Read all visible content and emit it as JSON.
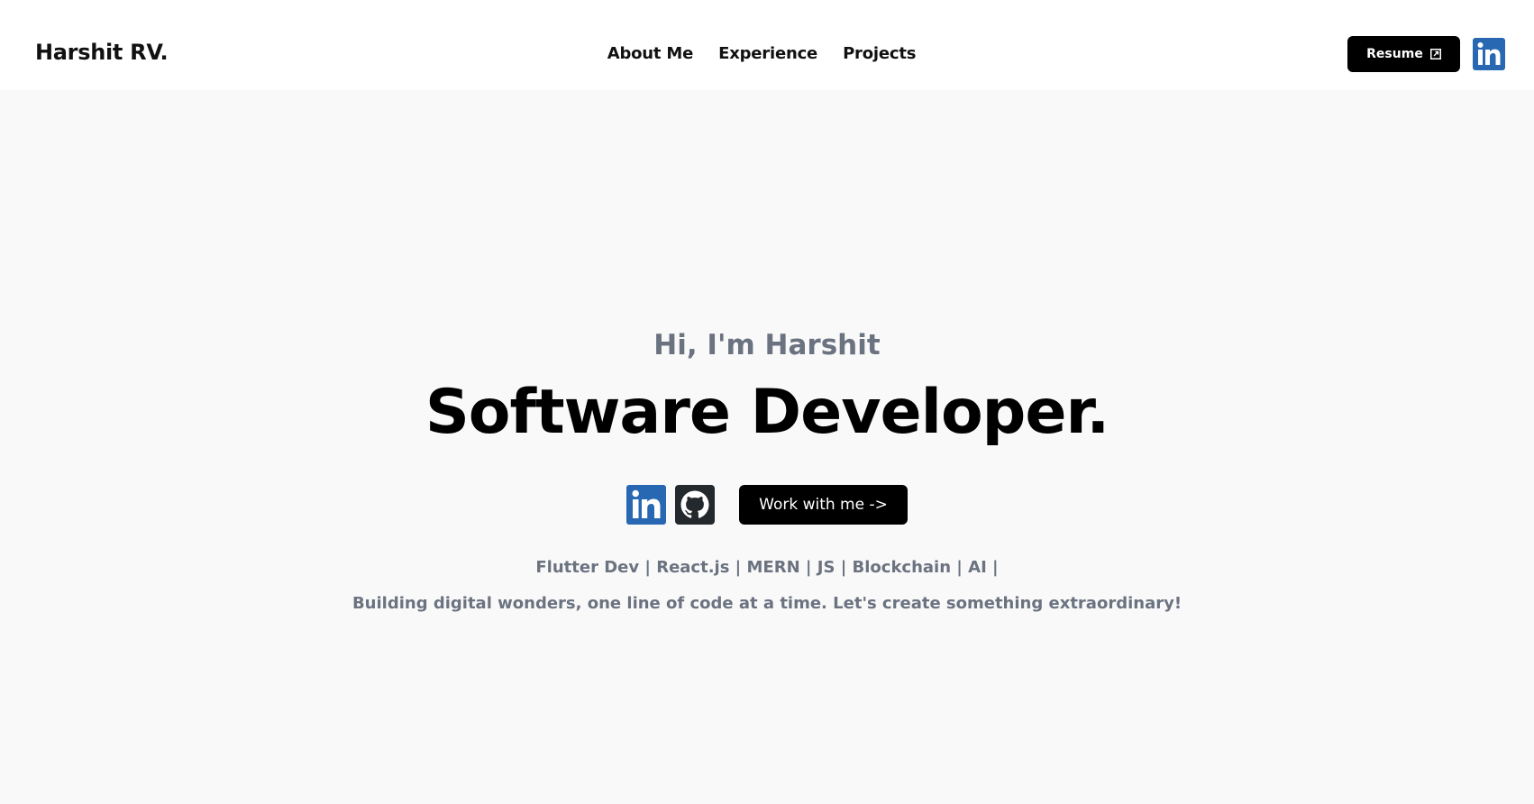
{
  "header": {
    "brand": "Harshit RV.",
    "nav": [
      "About Me",
      "Experience",
      "Projects"
    ],
    "resume_label": "Resume",
    "linkedin_icon": "linkedin-icon",
    "external_icon": "external-link-icon"
  },
  "hero": {
    "greeting": "Hi, I'm Harshit",
    "role": "Software Developer.",
    "social_icons": [
      "linkedin-icon",
      "github-icon"
    ],
    "cta_label": "Work with me ->",
    "skills": "Flutter Dev | React.js | MERN | JS | Blockchain | AI |",
    "tagline": "Building digital wonders, one line of code at a time. Let's create something extraordinary!"
  },
  "colors": {
    "accent": "#000000",
    "muted_text": "#6b7280",
    "linkedin_blue": "#2867b2",
    "github_dark": "#24292e",
    "background": "#f9f9f9"
  }
}
